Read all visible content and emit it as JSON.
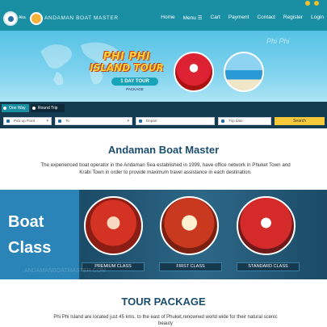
{
  "header": {
    "logo_text": "Aka",
    "brand": "ANDAMAN BOAT MASTER",
    "nav": [
      "Home",
      "Menu ☰",
      "Cart",
      "Payment",
      "Contact",
      "Register",
      "Login"
    ]
  },
  "hero": {
    "title_line1": "PHI PHI",
    "title_line2": "ISLAND TOUR",
    "badge": "1 DAY TOUR",
    "sub": "PACKAGE",
    "overlay_text": "Phi Phi"
  },
  "search": {
    "tabs": [
      "One Way",
      "Round Trip"
    ],
    "from_placeholder": "Pick up Point",
    "to_placeholder": "To",
    "depart_placeholder": "Depart",
    "date_placeholder": "Trip date",
    "button": "Search"
  },
  "about": {
    "title": "Andaman Boat Master",
    "text": "The experienced boat operator in the Andaman Sea established in 1999, have office network in Phuket Town and Krabi Town in order to provide maximum travel assistance in each destination."
  },
  "boat": {
    "title_line1": "Boat",
    "title_line2": "Class",
    "classes": [
      "PREMIUM CLASS",
      "FIRST CLASS",
      "STANDARD CLASS"
    ],
    "watermark": "ANDAMANBOATMASTER.COM"
  },
  "tour": {
    "title": "TOUR PACKAGE",
    "text": "Phi Phi Island are located just 45 kms. to the east of Phuket,renowned world wide for their natural scenic beauty"
  },
  "colors": {
    "header": "#1a8ea2",
    "search_bg": "#133c51",
    "search_button": "#f7c83a",
    "boat_section": "#1d4f69",
    "title_text": "#1b4d6e"
  }
}
